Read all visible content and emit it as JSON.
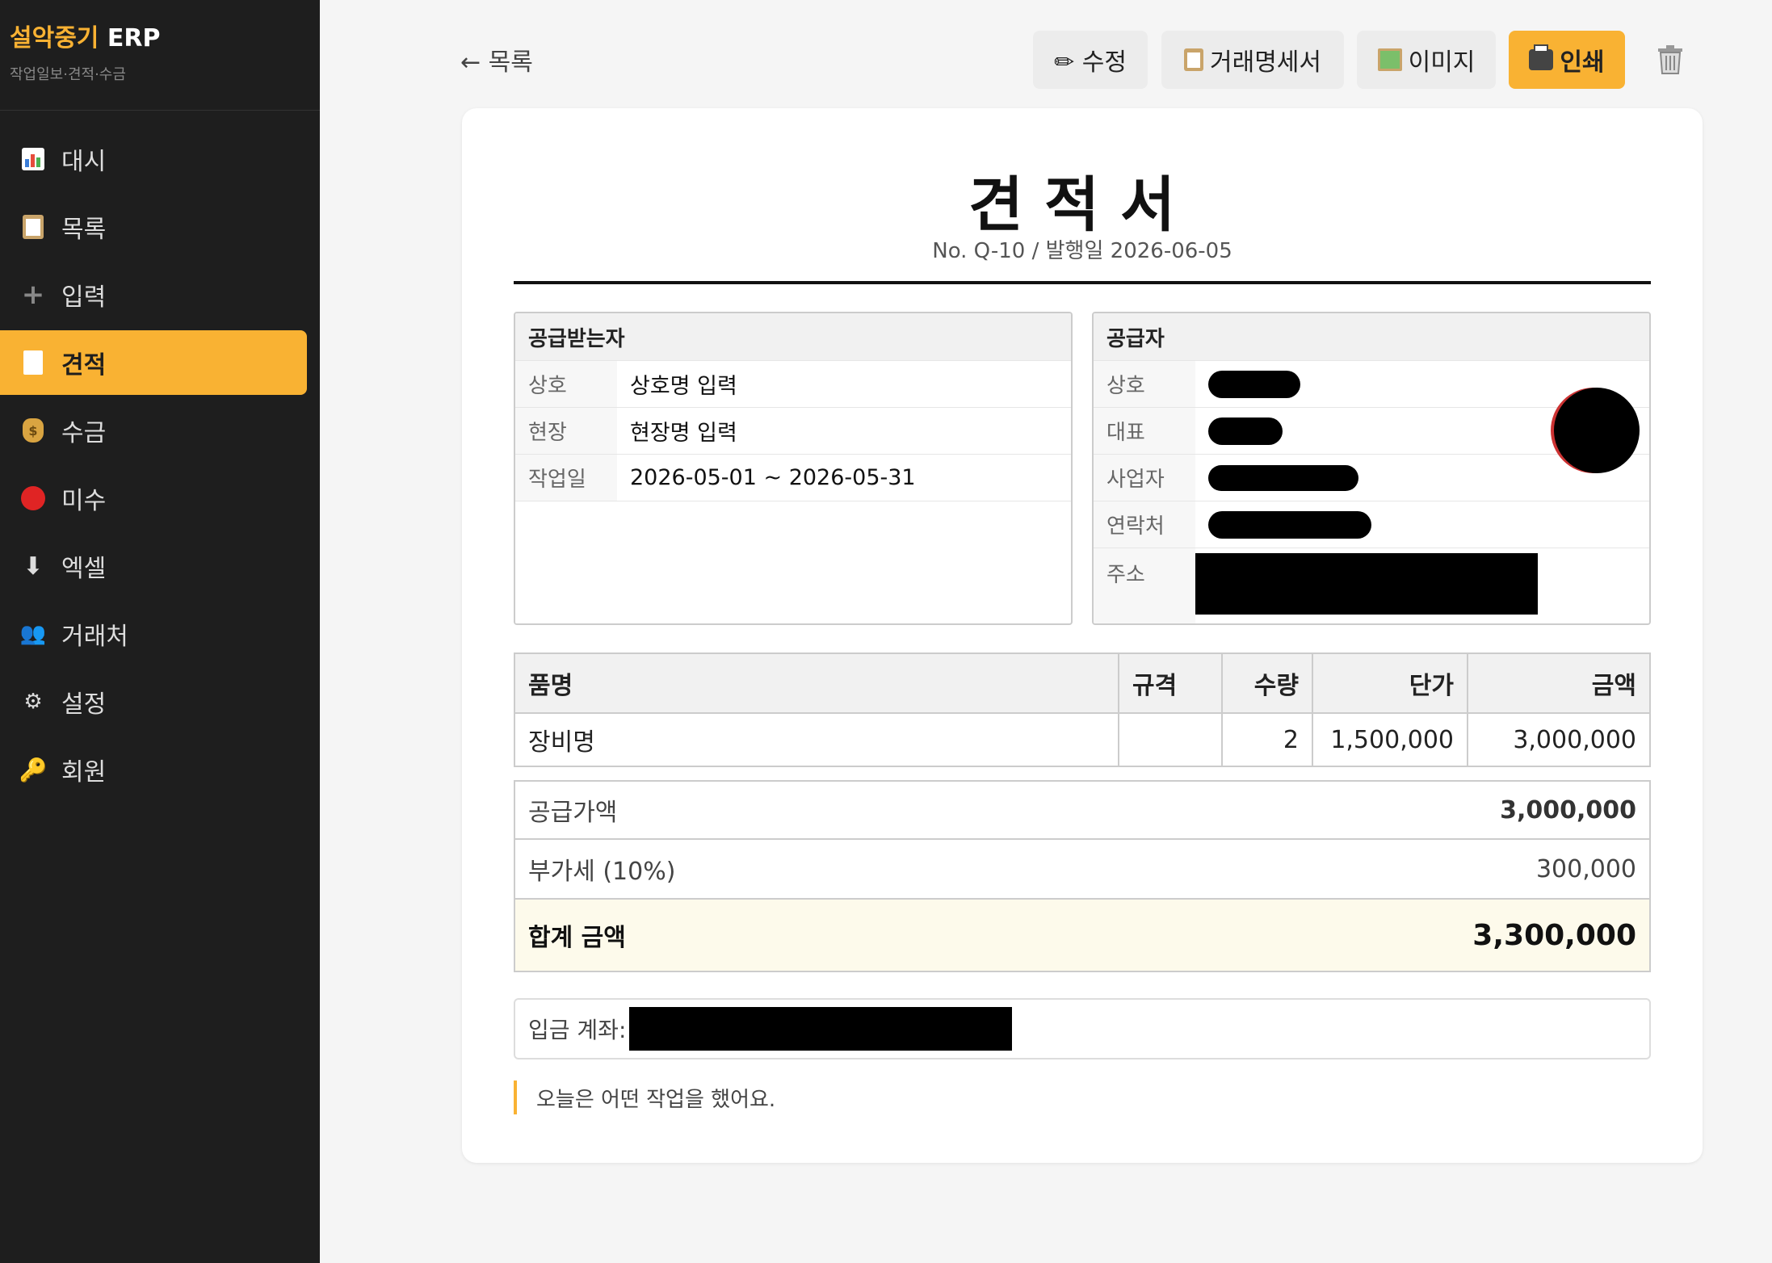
{
  "app": {
    "brand_prefix": "설악중기",
    "brand_suffix": " ERP",
    "subtitle": "작업일보·견적·수금"
  },
  "nav": [
    {
      "label": "대시",
      "icon": "bar-chart-icon"
    },
    {
      "label": "목록",
      "icon": "clipboard-icon"
    },
    {
      "label": "입력",
      "icon": "plus-icon"
    },
    {
      "label": "견적",
      "icon": "document-icon",
      "active": true
    },
    {
      "label": "수금",
      "icon": "money-bag-icon"
    },
    {
      "label": "미수",
      "icon": "red-circle-icon"
    },
    {
      "label": "엑셀",
      "icon": "download-arrow-icon"
    },
    {
      "label": "거래처",
      "icon": "people-icon"
    },
    {
      "label": "설정",
      "icon": "gear-icon"
    },
    {
      "label": "회원",
      "icon": "key-icon"
    }
  ],
  "toolbar": {
    "back_label": "← 목록",
    "edit_label": "✏ 수정",
    "statement_label": "거래명세서",
    "image_label": "이미지",
    "print_label": "인쇄",
    "delete_icon": "trash-icon"
  },
  "document": {
    "title": "견적서",
    "meta": "No. Q-10 / 발행일 2026-06-05",
    "recipient": {
      "heading": "공급받는자",
      "rows": [
        {
          "key": "상호",
          "value": "상호명 입력"
        },
        {
          "key": "현장",
          "value": "현장명 입력"
        },
        {
          "key": "작업일",
          "value": "2026-05-01 ~ 2026-05-31"
        }
      ]
    },
    "supplier": {
      "heading": "공급자",
      "rows": [
        {
          "key": "상호"
        },
        {
          "key": "대표"
        },
        {
          "key": "사업자"
        },
        {
          "key": "연락처"
        },
        {
          "key": "주소"
        }
      ]
    },
    "items": {
      "headers": [
        "품명",
        "규격",
        "수량",
        "단가",
        "금액"
      ],
      "rows": [
        {
          "name": "장비명",
          "spec": "",
          "qty": "2",
          "unit_price": "1,500,000",
          "amount": "3,000,000"
        }
      ]
    },
    "totals": {
      "supply_label": "공급가액",
      "supply_value": "3,000,000",
      "vat_label": "부가세 (10%)",
      "vat_value": "300,000",
      "total_label": "합계 금액",
      "total_value": "3,300,000"
    },
    "account_label": "입금 계좌:",
    "note": "오늘은 어떤 작업을 했어요."
  }
}
